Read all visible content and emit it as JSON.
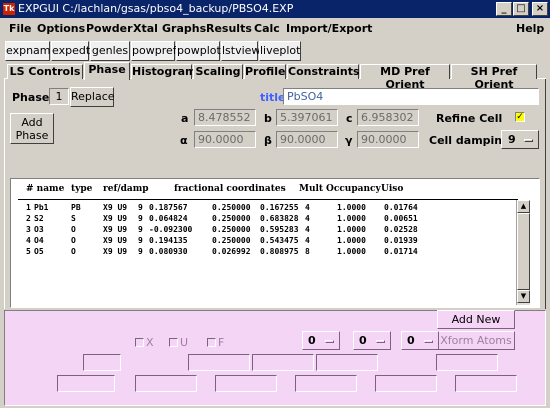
{
  "window": {
    "title": "EXPGUI C:/lachlan/gsas/pbso4_backup/PBSO4.EXP",
    "app_icon": "Tk",
    "controls": {
      "minimize": "_",
      "maximize": "□",
      "close": "×"
    }
  },
  "menubar": {
    "items": [
      "File",
      "Options",
      "Powder",
      "Xtal",
      "Graphs",
      "Results",
      "Calc",
      "Import/Export"
    ],
    "help": "Help"
  },
  "toolbar": {
    "buttons": [
      "expnam",
      "expedt",
      "genles",
      "powpref",
      "powplot",
      "lstview",
      "liveplot"
    ]
  },
  "tabs": [
    "LS Controls",
    "Phase",
    "Histogram",
    "Scaling",
    "Profile",
    "Constraints",
    "MD Pref Orient",
    "SH Pref Orient"
  ],
  "phase": {
    "label": "Phase:",
    "number": "1",
    "replace": "Replace",
    "add_phase_line1": "Add",
    "add_phase_line2": "Phase",
    "title_label": "title:",
    "title_value": "PbSO4",
    "a_label": "a",
    "a": "8.478552",
    "b_label": "b",
    "b": "5.397061",
    "c_label": "c",
    "c": "6.958302",
    "alpha_label": "α",
    "alpha": "90.0000",
    "beta_label": "β",
    "beta": "90.0000",
    "gamma_label": "γ",
    "gamma": "90.0000",
    "refine_cell_label": "Refine Cell",
    "refine_cell_checked": "✓",
    "cell_damping_label": "Cell damping",
    "cell_damping_value": "9"
  },
  "atoms": {
    "headers": {
      "num": "# name",
      "type": "type",
      "ref": "ref/damp",
      "coords": "fractional coordinates",
      "mult": "Mult",
      "occ": "Occupancy",
      "uiso": "Uiso"
    },
    "rows": [
      {
        "n": "1",
        "name": "Pb1",
        "type": "PB",
        "ref": "X9 U9",
        "damp": "9",
        "x": "0.187567",
        "y": "0.250000",
        "z": "0.167255",
        "mult": "4",
        "occ": "1.0000",
        "uiso": "0.01764"
      },
      {
        "n": "2",
        "name": "S2",
        "type": "S",
        "ref": "X9 U9",
        "damp": "9",
        "x": "0.064824",
        "y": "0.250000",
        "z": "0.683828",
        "mult": "4",
        "occ": "1.0000",
        "uiso": "0.00651"
      },
      {
        "n": "3",
        "name": "O3",
        "type": "O",
        "ref": "X9 U9",
        "damp": "9",
        "x": "-0.092300",
        "y": "0.250000",
        "z": "0.595283",
        "mult": "4",
        "occ": "1.0000",
        "uiso": "0.02528"
      },
      {
        "n": "4",
        "name": "O4",
        "type": "O",
        "ref": "X9 U9",
        "damp": "9",
        "x": "0.194135",
        "y": "0.250000",
        "z": "0.543475",
        "mult": "4",
        "occ": "1.0000",
        "uiso": "0.01939"
      },
      {
        "n": "5",
        "name": "O5",
        "type": "O",
        "ref": "X9 U9",
        "damp": "9",
        "x": "0.080930",
        "y": "0.026992",
        "z": "0.808975",
        "mult": "8",
        "occ": "1.0000",
        "uiso": "0.01714"
      }
    ]
  },
  "lower": {
    "add_new_atoms": "Add New Atoms",
    "xform_atoms": "Xform Atoms",
    "chk_x": "X",
    "chk_u": "U",
    "chk_f": "F",
    "menu1": "0",
    "menu2": "0",
    "menu3": "0"
  }
}
